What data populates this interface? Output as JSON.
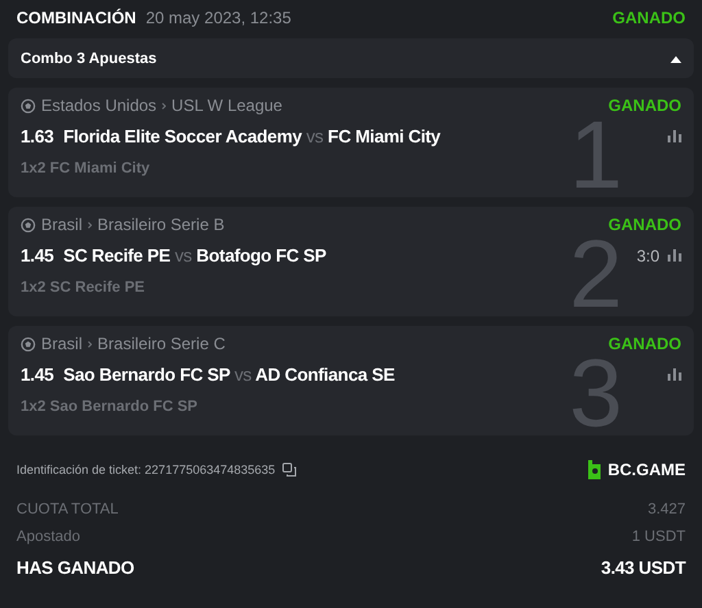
{
  "header": {
    "title": "COMBINACIÓN",
    "date": "20 may 2023, 12:35",
    "status": "GANADO"
  },
  "combo": {
    "label": "Combo 3 Apuestas",
    "expanded": true
  },
  "bets": [
    {
      "index": "1",
      "country": "Estados Unidos",
      "league": "USL W League",
      "status": "GANADO",
      "odds": "1.63",
      "home": "Florida Elite Soccer Academy",
      "vs": "vs",
      "away": "FC Miami City",
      "market": "1x2 FC Miami City"
    },
    {
      "index": "2",
      "country": "Brasil",
      "league": "Brasileiro Serie B",
      "status": "GANADO",
      "odds": "1.45",
      "home": "SC Recife PE",
      "vs": "vs",
      "away": "Botafogo FC SP",
      "score": "3:0",
      "market": "1x2 SC Recife PE"
    },
    {
      "index": "3",
      "country": "Brasil",
      "league": "Brasileiro Serie C",
      "status": "GANADO",
      "odds": "1.45",
      "home": "Sao Bernardo FC SP",
      "vs": "vs",
      "away": "AD Confianca SE",
      "market": "1x2 Sao Bernardo FC SP"
    }
  ],
  "ticket": {
    "label": "Identificación de ticket: 2271775063474835635"
  },
  "brand": "BC.GAME",
  "totals": [
    {
      "kind": "muted",
      "label": "CUOTA TOTAL",
      "value": "3.427"
    },
    {
      "kind": "muted",
      "label": "Apostado",
      "value": "1 USDT"
    },
    {
      "kind": "strong",
      "label": "HAS GANADO",
      "value": "3.43 USDT"
    }
  ]
}
